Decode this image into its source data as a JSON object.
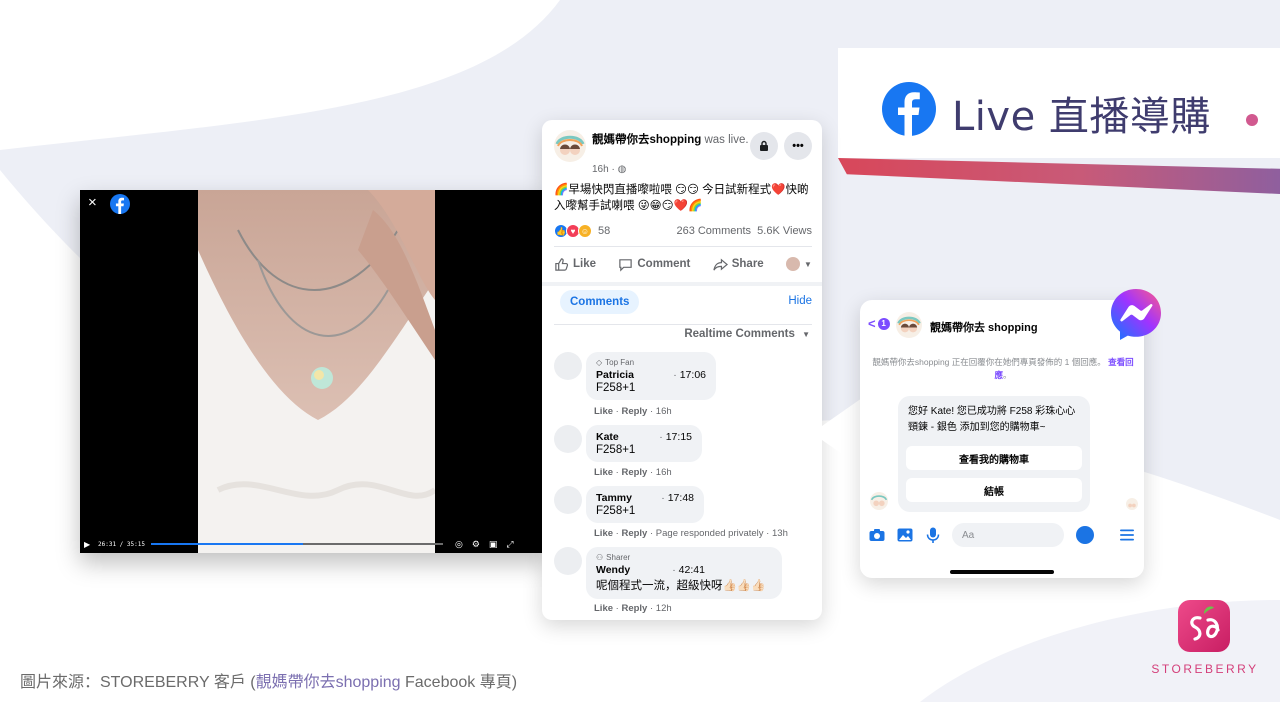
{
  "banner": {
    "title": "Live 直播導購",
    "brand_color": "#1877f2",
    "text_color": "#3f3c6e"
  },
  "video": {
    "close": "×",
    "time": "26:31 / 35:15",
    "progress_fraction": 0.52
  },
  "post": {
    "page_name": "靚媽帶你去shopping",
    "was_live": "was live.",
    "time_ago": "16h",
    "text": "🌈早場快閃直播嚟啦喂 😏😏 今日試新程式❤️快啲入嚟幫手試喇喂 😜😁😏❤️🌈",
    "reaction_count": "58",
    "comments_count": "263 Comments",
    "views_count": "5.6K Views",
    "actions": {
      "like": "Like",
      "comment": "Comment",
      "share": "Share"
    },
    "comments_tab": "Comments",
    "hide": "Hide",
    "sort_label": "Realtime Comments",
    "comments": [
      {
        "badge": "Top Fan",
        "name": "Patricia",
        "time": "17:06",
        "text": "F258+1",
        "like": "Like",
        "reply": "Reply",
        "extra": "",
        "ago": "16h"
      },
      {
        "badge": "",
        "name": "Kate",
        "time": "17:15",
        "text": "F258+1",
        "like": "Like",
        "reply": "Reply",
        "extra": "",
        "ago": "16h"
      },
      {
        "badge": "",
        "name": "Tammy",
        "time": "17:48",
        "text": "F258+1",
        "like": "Like",
        "reply": "Reply",
        "extra": "Page responded privately",
        "ago": "13h"
      },
      {
        "badge": "Sharer",
        "name": "Wendy",
        "time": "42:41",
        "text": "呢個程式一流，超級快呀👍🏻👍🏻👍🏻",
        "like": "Like",
        "reply": "Reply",
        "extra": "",
        "ago": "12h"
      }
    ]
  },
  "messenger": {
    "back_count": "1",
    "page_name": "靚媽帶你去 shopping",
    "note": "靚媽帶你去shopping 正在回覆你在她們專頁發佈的 1 個回應。",
    "note_link": "查看回應",
    "message": "您好 Kate! 您已成功將 F258 彩珠心心頸鍊 - 銀色 添加到您的購物車~",
    "btn_cart": "查看我的購物車",
    "btn_checkout": "結帳",
    "input_placeholder": "Aa",
    "accent": "#7c4dff"
  },
  "footer": {
    "caption_prefix": "圖片來源：STOREBERRY 客戶 (",
    "caption_link": "靚媽帶你去shopping",
    "caption_suffix": " Facebook 專頁)",
    "brand_word": "STOREBERRY",
    "brand_color": "#d43f7a"
  }
}
